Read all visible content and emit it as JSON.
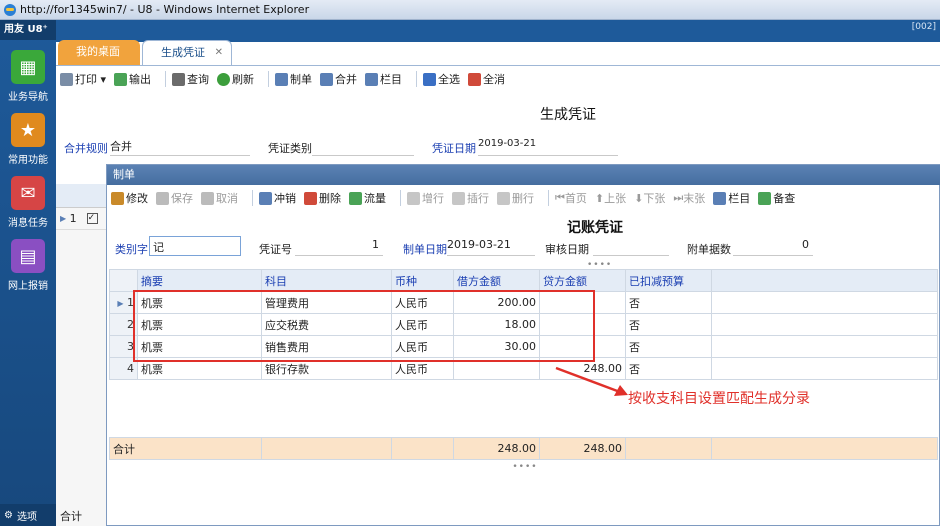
{
  "window": {
    "title": "http://for1345win7/ - U8 - Windows Internet Explorer",
    "corner": "[002]"
  },
  "sidebar": {
    "logo": "用友 U8⁺",
    "items": [
      {
        "label": "业务导航",
        "icon": "nav-icon",
        "color": "#3aa83a"
      },
      {
        "label": "常用功能",
        "icon": "star-icon",
        "color": "#e08a1e"
      },
      {
        "label": "消息任务",
        "icon": "mail-icon",
        "color": "#d64545"
      },
      {
        "label": "网上报销",
        "icon": "doc-icon",
        "color": "#8a4fc2"
      }
    ],
    "footer": "选项"
  },
  "tabs": [
    {
      "label": "我的桌面"
    },
    {
      "label": "生成凭证"
    }
  ],
  "toolbar1": {
    "print": "打印",
    "output": "输出",
    "query": "查询",
    "refresh": "刷新",
    "make": "制单",
    "merge": "合并",
    "columns": "栏目",
    "select_all": "全选",
    "deselect_all": "全消"
  },
  "main": {
    "title": "生成凭证",
    "merge_rule_label": "合并规则",
    "merge_rule_value": "合并",
    "voucher_type_label": "凭证类别",
    "voucher_date_label": "凭证日期",
    "voucher_date_value": "2019-03-21",
    "stub_row": "1",
    "stub_footer": "合计"
  },
  "dialog": {
    "title": "制单",
    "toolbar": {
      "edit": "修改",
      "save": "保存",
      "cancel": "取消",
      "pending": "冲销",
      "delete": "删除",
      "flow": "流量",
      "add_row": "增行",
      "insert_row": "插行",
      "delete_row": "删行",
      "first": "首页",
      "prev": "上张",
      "next": "下张",
      "last": "末张",
      "columns": "栏目",
      "check": "备查"
    },
    "voucher_title": "记账凭证",
    "category_label": "类别字",
    "category_value": "记",
    "voucher_no_label": "凭证号",
    "voucher_no_value": "1",
    "date_label": "制单日期",
    "date_value": "2019-03-21",
    "audit_label": "审核日期",
    "audit_value": "",
    "attach_label": "附单据数",
    "attach_value": "0"
  },
  "grid": {
    "headers": [
      "摘要",
      "科目",
      "币种",
      "借方金额",
      "贷方金额",
      "已扣减预算"
    ],
    "rows": [
      {
        "n": "1",
        "summary": "机票",
        "account": "管理费用",
        "currency": "人民币",
        "debit": "200.00",
        "credit": "",
        "budget": "否"
      },
      {
        "n": "2",
        "summary": "机票",
        "account": "应交税费",
        "currency": "人民币",
        "debit": "18.00",
        "credit": "",
        "budget": "否"
      },
      {
        "n": "3",
        "summary": "机票",
        "account": "销售费用",
        "currency": "人民币",
        "debit": "30.00",
        "credit": "",
        "budget": "否"
      },
      {
        "n": "4",
        "summary": "机票",
        "account": "银行存款",
        "currency": "人民币",
        "debit": "",
        "credit": "248.00",
        "budget": "否"
      }
    ],
    "total_label": "合计",
    "total_debit": "248.00",
    "total_credit": "248.00"
  },
  "annotation": "按收支科目设置匹配生成分录"
}
